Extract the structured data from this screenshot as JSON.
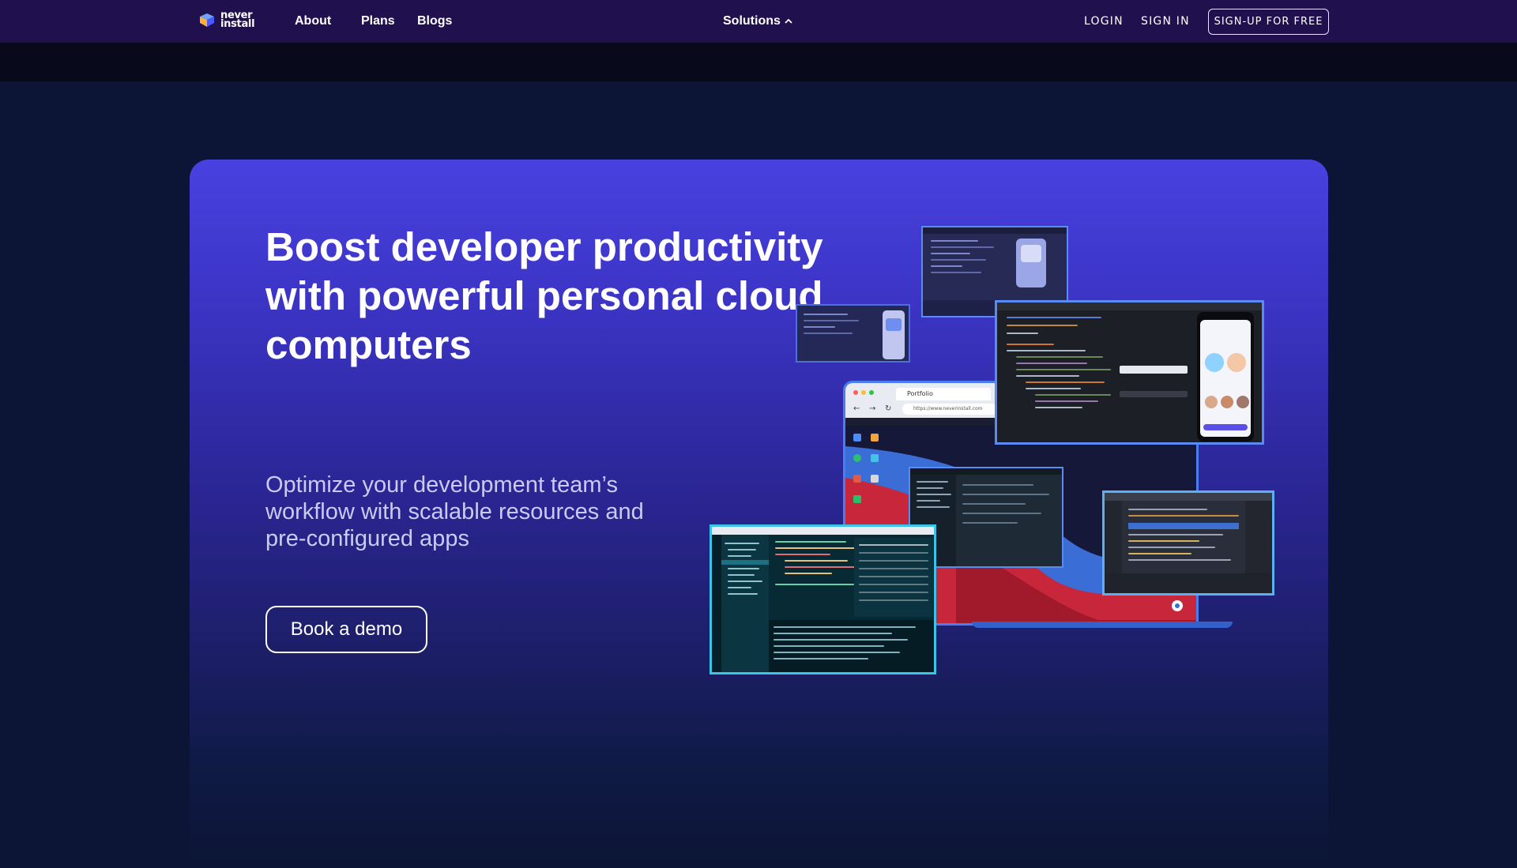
{
  "nav": {
    "logo_line1": "never",
    "logo_line2": "install",
    "about": "About",
    "plans": "Plans",
    "blogs": "Blogs",
    "solutions": "Solutions",
    "login": "LOGIN",
    "sign_in": "SIGN IN",
    "signup": "SIGN-UP FOR FREE"
  },
  "hero": {
    "title": "Boost developer productivity with powerful personal cloud computers",
    "subtitle": "Optimize your development team’s workflow with scalable resources and pre-configured apps",
    "cta": "Book a demo"
  },
  "collage": {
    "browser_tab": "Portfolio",
    "browser_url": "https://www.neverinstall.com"
  },
  "colors": {
    "nav_bg": "#21104e",
    "hero_accent": "#4941e0",
    "text": "#ffffff"
  }
}
